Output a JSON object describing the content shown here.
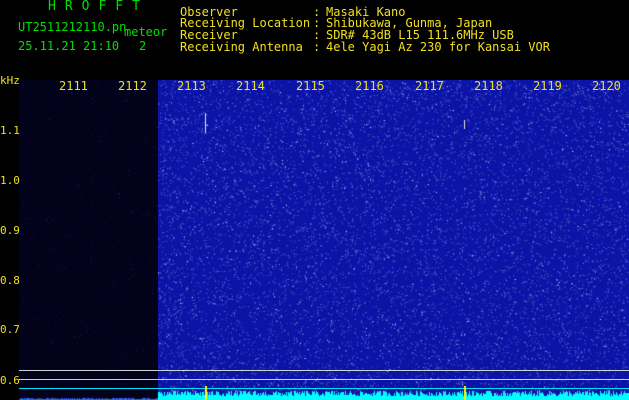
{
  "brand": "HROFFT",
  "file_name": "UT2511212110.pn",
  "mode_label": "meteor",
  "datetime": "25.11.21 21:10",
  "count": "2",
  "info": [
    {
      "label": "Observer",
      "value": "Masaki Kano"
    },
    {
      "label": "Receiving Location",
      "value": "Shibukawa, Gunma, Japan"
    },
    {
      "label": "Receiver",
      "value": "SDR# 43dB L15 111.6MHz USB"
    },
    {
      "label": "Receiving Antenna",
      "value": "4ele Yagi Az 230 for Kansai VOR"
    }
  ],
  "colon": ":",
  "unit_label": "kHz",
  "x_ticks": [
    "2111",
    "2112",
    "2113",
    "2114",
    "2115",
    "2116",
    "2117",
    "2118",
    "2119",
    "2120"
  ],
  "y_ticks": [
    "1.1",
    "1.0",
    "0.9",
    "0.8",
    "0.7",
    "0.6"
  ],
  "colors": {
    "header_green": "#00e000",
    "header_yellow": "#f0e020",
    "spectrogram_blue": "#0c14a8",
    "trace_cyan": "#00ffff",
    "echo_yellow": "#ffff00"
  }
}
